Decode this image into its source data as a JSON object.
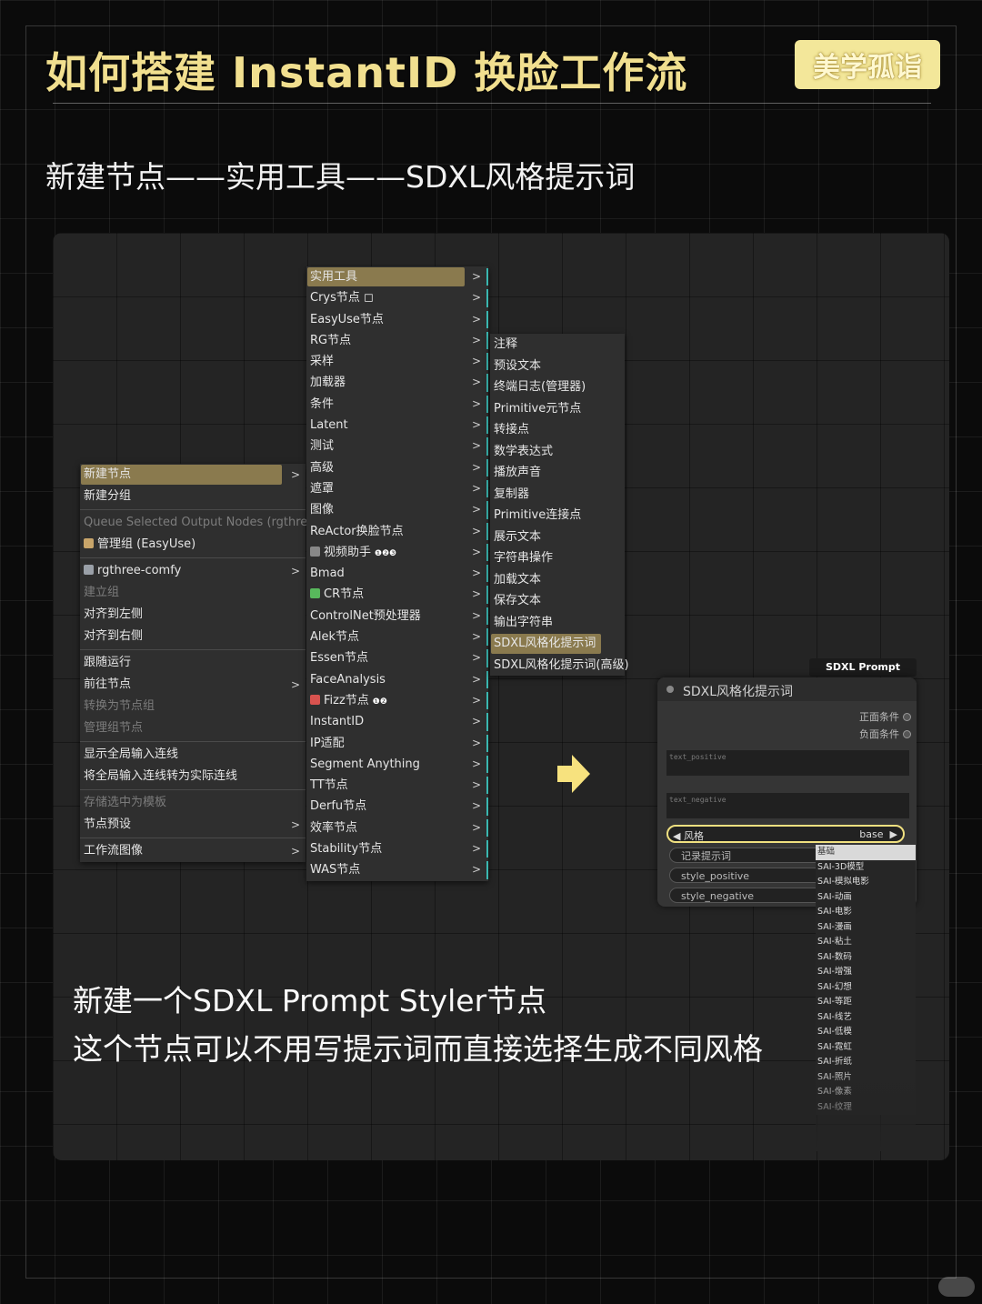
{
  "header": {
    "title": "如何搭建 InstantID 换脸工作流",
    "brand": "美学孤诣"
  },
  "subtitle": "新建节点——实用工具——SDXL风格提示词",
  "context_menu": {
    "items": [
      {
        "label": "新建节点",
        "state": "selected",
        "arrow": ">"
      },
      {
        "label": "新建分组",
        "state": "normal"
      },
      {
        "sep": true
      },
      {
        "label": "Queue Selected Output Nodes (rgthree)",
        "state": "disabled"
      },
      {
        "label": "管理组 (EasyUse)",
        "state": "normal",
        "icon": "scroll-icon"
      },
      {
        "sep": true
      },
      {
        "label": "rgthree-comfy",
        "state": "normal",
        "icon": "rgthree-icon",
        "arrow": ">"
      },
      {
        "label": "建立组",
        "state": "disabled"
      },
      {
        "label": "对齐到左侧",
        "state": "normal"
      },
      {
        "label": "对齐到右侧",
        "state": "normal"
      },
      {
        "sep": true
      },
      {
        "label": "跟随运行",
        "state": "normal"
      },
      {
        "label": "前往节点",
        "state": "normal",
        "arrow": ">"
      },
      {
        "label": "转换为节点组",
        "state": "disabled"
      },
      {
        "label": "管理组节点",
        "state": "disabled"
      },
      {
        "sep": true
      },
      {
        "label": "显示全局输入连线",
        "state": "normal"
      },
      {
        "label": "将全局输入连线转为实际连线",
        "state": "normal"
      },
      {
        "sep": true
      },
      {
        "label": "存储选中为模板",
        "state": "disabled"
      },
      {
        "label": "节点预设",
        "state": "normal",
        "arrow": ">"
      },
      {
        "sep": true
      },
      {
        "label": "工作流图像",
        "state": "normal",
        "arrow": ">"
      }
    ]
  },
  "tools_menu": {
    "items": [
      {
        "label": "实用工具",
        "state": "selected"
      },
      {
        "label": "Crys节点 ◻"
      },
      {
        "label": "EasyUse节点"
      },
      {
        "label": "RG节点"
      },
      {
        "label": "采样"
      },
      {
        "label": "加载器"
      },
      {
        "label": "条件"
      },
      {
        "label": "Latent"
      },
      {
        "label": "测试"
      },
      {
        "label": "高级"
      },
      {
        "label": "遮罩"
      },
      {
        "label": "图像"
      },
      {
        "label": "ReActor换脸节点"
      },
      {
        "label": "视频助手",
        "icon": "film-icon",
        "badge": "❶❷❸"
      },
      {
        "label": "Bmad"
      },
      {
        "label": "CR节点",
        "icon": "cr-icon"
      },
      {
        "label": "ControlNet预处理器"
      },
      {
        "label": "Alek节点"
      },
      {
        "label": "Essen节点"
      },
      {
        "label": "FaceAnalysis"
      },
      {
        "label": "Fizz节点",
        "icon": "calendar-icon",
        "badge": "❶❷"
      },
      {
        "label": "InstantID"
      },
      {
        "label": "IP适配"
      },
      {
        "label": "Segment Anything"
      },
      {
        "label": "TT节点"
      },
      {
        "label": "Derfu节点"
      },
      {
        "label": "效率节点"
      },
      {
        "label": "Stability节点"
      },
      {
        "label": "WAS节点"
      }
    ],
    "arrow": ">"
  },
  "util_menu": {
    "items": [
      {
        "label": "注释"
      },
      {
        "label": "预设文本"
      },
      {
        "label": "终端日志(管理器)"
      },
      {
        "label": "Primitive元节点"
      },
      {
        "label": "转接点"
      },
      {
        "label": "数学表达式"
      },
      {
        "label": "播放声音"
      },
      {
        "label": "复制器"
      },
      {
        "label": "Primitive连接点"
      },
      {
        "label": "展示文本"
      },
      {
        "label": "字符串操作"
      },
      {
        "label": "加载文本"
      },
      {
        "label": "保存文本"
      },
      {
        "label": "输出字符串"
      },
      {
        "label": "SDXL风格化提示词",
        "state": "selected"
      },
      {
        "label": "SDXL风格化提示词(高级)"
      }
    ]
  },
  "node": {
    "tag": "SDXL Prompt Styler",
    "title": "SDXL风格化提示词",
    "outputs": [
      "正面条件",
      "负面条件"
    ],
    "text_positive_placeholder": "text_positive",
    "text_negative_placeholder": "text_negative",
    "combo_label": "◀ 风格",
    "combo_value": "base",
    "combo_right_arrow": "▶",
    "widgets": [
      "记录提示词",
      "style_positive",
      "style_negative"
    ]
  },
  "style_dropdown": [
    "基础",
    "SAI-3D模型",
    "SAI-模拟电影",
    "SAI-动画",
    "SAI-电影",
    "SAI-漫画",
    "SAI-粘土",
    "SAI-数码",
    "SAI-增强",
    "SAI-幻想",
    "SAI-等距",
    "SAI-线艺",
    "SAI-低模",
    "SAI-霓虹",
    "SAI-折纸",
    "SAI-照片",
    "SAI-像素",
    "SAI-纹理"
  ],
  "captions": [
    "新建一个SDXL Prompt Styler节点",
    "这个节点可以不用写提示词而直接选择生成不同风格"
  ],
  "colors": {
    "title": "#f1df8f",
    "badge_bg": "#f3e79a",
    "menu_selected": "#8a7a4e",
    "teal_accent": "#39b7b0",
    "combo_border": "#f0e080",
    "arrow": "#f7e27e"
  }
}
